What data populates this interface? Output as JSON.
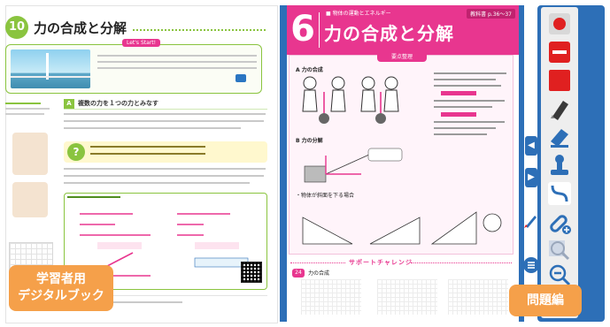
{
  "left_page": {
    "chapter_number": "10",
    "title": "力の合成と分解",
    "lets_start_label": "Let's Start!",
    "section_a_tag": "A",
    "section_a_title": "複数の力を１つの力とみなす"
  },
  "right_page": {
    "chapter_number": "6",
    "chapter_subtitle": "■ 物体の運動とエネルギー",
    "title": "力の合成と分解",
    "page_ref": "教科書 p.36〜37",
    "summary_tab": "要点整理",
    "section_a_heading": "A 力の合成",
    "section_b_heading": "B 力の分解",
    "section_c_note": "・物体が斜面を下る場合",
    "practice_header": "サポートチャレンジ",
    "practice_number": "24",
    "practice_text": "力の合成"
  },
  "overlay_labels": {
    "left_line1": "学習者用",
    "left_line2": "デジタルブック",
    "right": "問題編"
  },
  "toolbar": {
    "tools": [
      {
        "icon": "record-icon",
        "color": "#e02020"
      },
      {
        "icon": "marker-line-icon",
        "color": "#e02020"
      },
      {
        "icon": "red-square-icon",
        "color": "#e02020"
      },
      {
        "icon": "highlighter-icon",
        "color": "#2d6fb7"
      },
      {
        "icon": "eraser-icon",
        "color": "#2d6fb7"
      },
      {
        "icon": "stamp-icon",
        "color": "#2d6fb7"
      },
      {
        "icon": "curve-line-icon",
        "color": "#2d6fb7"
      },
      {
        "icon": "link-add-icon",
        "color": "#2d6fb7"
      },
      {
        "icon": "search-zoom-icon",
        "color": "#2d6fb7"
      },
      {
        "icon": "zoom-out-icon",
        "color": "#2d6fb7"
      },
      {
        "icon": "zoom-in-icon",
        "color": "#2d6fb7"
      }
    ]
  },
  "colors": {
    "brand_blue": "#2d6fb7",
    "accent_pink": "#e8368f",
    "accent_green": "#8ac43f",
    "label_orange": "#f5a04a"
  }
}
